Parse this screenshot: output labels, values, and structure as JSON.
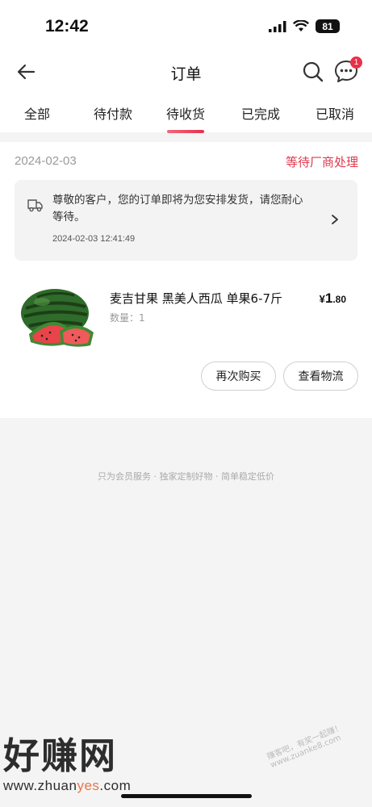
{
  "status_bar": {
    "time": "12:42",
    "battery": "81"
  },
  "nav": {
    "title": "订单",
    "message_badge": "1"
  },
  "tabs": [
    {
      "label": "全部"
    },
    {
      "label": "待付款"
    },
    {
      "label": "待收货",
      "active": true
    },
    {
      "label": "已完成"
    },
    {
      "label": "已取消"
    }
  ],
  "order": {
    "date": "2024-02-03",
    "status": "等待厂商处理",
    "notice": {
      "text": "尊敬的客户，您的订单即将为您安排发货，请您耐心等待。",
      "time": "2024-02-03 12:41:49"
    },
    "product": {
      "name": "麦吉甘果 黑美人西瓜 单果6-7斤",
      "quantity": "数量：1",
      "price_currency": "¥",
      "price_int": "1",
      "price_dec": ".80"
    },
    "buttons": {
      "rebuy": "再次购买",
      "logistics": "查看物流"
    }
  },
  "footer": {
    "slogan": "只为会员服务 · 独家定制好物 · 简单稳定低价"
  },
  "watermark": {
    "big": "好赚网",
    "url_pre": "www.zhuan",
    "url_hl": "yes",
    "url_post": ".com",
    "side": "赚客吧，有奖一起赚！www.zuanke8.com"
  },
  "colors": {
    "accent": "#e8304a",
    "status": "#e0384e"
  }
}
